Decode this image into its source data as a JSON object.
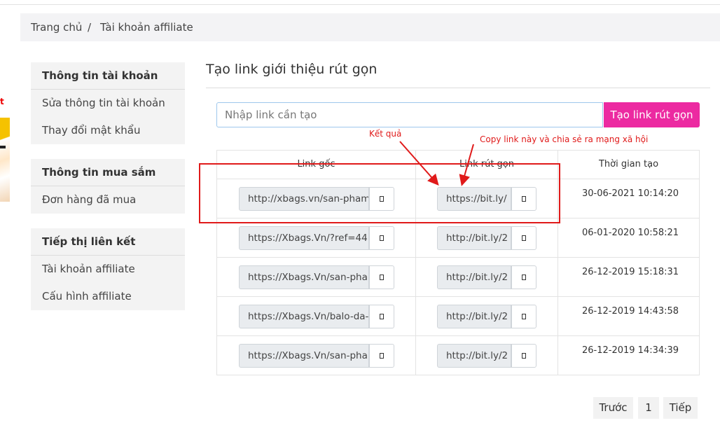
{
  "breadcrumb": {
    "home": "Trang chủ",
    "separator": "/",
    "current": "Tài khoản affiliate"
  },
  "left_banner": {
    "text": "t"
  },
  "sidebar": {
    "account": {
      "header": "Thông tin tài khoản",
      "items": [
        "Sửa thông tin tài khoản",
        "Thay đổi mật khẩu"
      ]
    },
    "shopping": {
      "header": "Thông tin mua sắm",
      "items": [
        "Đơn hàng đã mua"
      ]
    },
    "affiliate": {
      "header": "Tiếp thị liên kết",
      "items": [
        "Tài khoản affiliate",
        "Cấu hình affiliate"
      ]
    }
  },
  "main": {
    "title": "Tạo link giới thiệu rút gọn",
    "input_placeholder": "Nhập link cần tạo",
    "create_button": "Tạo link rút gọn"
  },
  "annotations": {
    "result_label": "Kết quả",
    "copy_label": "Copy link này và chia sẻ ra mạng xã hội"
  },
  "table": {
    "headers": [
      "Link gốc",
      "Link rút gọn",
      "Thời gian tạo"
    ],
    "rows": [
      {
        "original": "http://xbags.vn/san-pham",
        "short": "https://bit.ly/",
        "created": "30-06-2021 10:14:20"
      },
      {
        "original": "https://Xbags.Vn/?ref=44",
        "short": "http://bit.ly/2",
        "created": "06-01-2020 10:58:21"
      },
      {
        "original": "https://Xbags.Vn/san-pha",
        "short": "http://bit.ly/2",
        "created": "26-12-2019 15:18:31"
      },
      {
        "original": "https://Xbags.Vn/balo-da-",
        "short": "http://bit.ly/2",
        "created": "26-12-2019 14:43:58"
      },
      {
        "original": "https://Xbags.Vn/san-pha",
        "short": "http://bit.ly/2",
        "created": "26-12-2019 14:34:39"
      }
    ]
  },
  "pagination": {
    "prev": "Trước",
    "page": "1",
    "next": "Tiếp"
  },
  "colors": {
    "accent": "#ec2aa1",
    "annotation": "#e01a1a",
    "panel_bg": "#f3f3f3"
  }
}
